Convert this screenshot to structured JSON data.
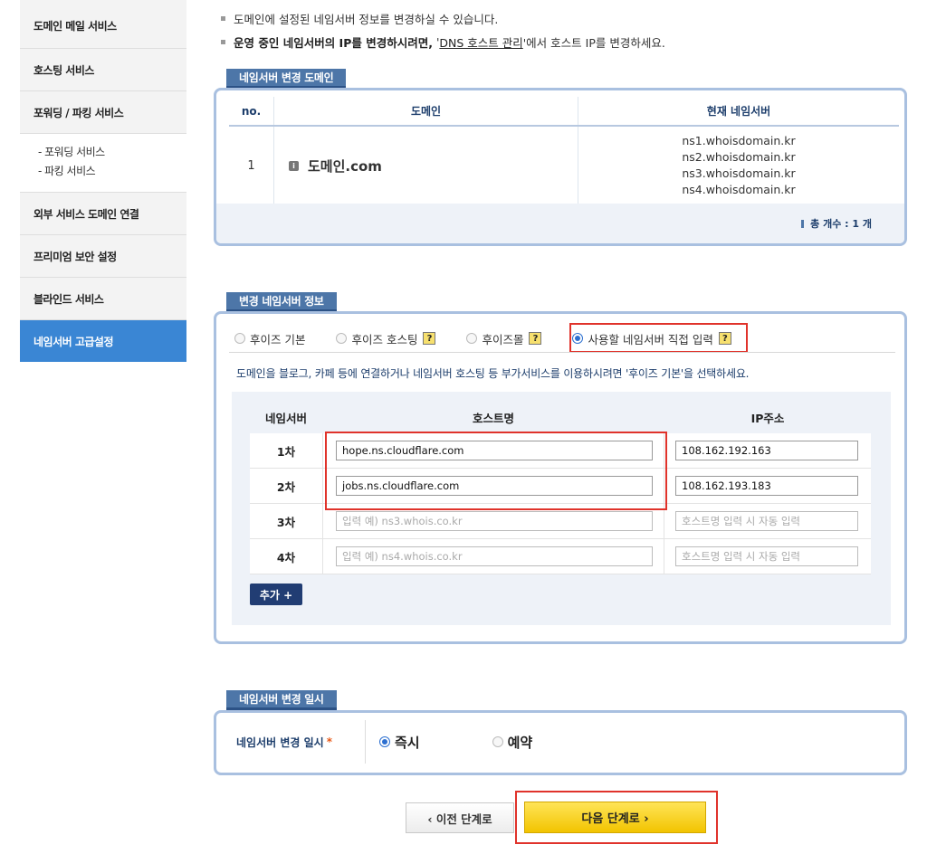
{
  "sidebar": {
    "items": [
      {
        "label": "도메인 메일 서비스"
      },
      {
        "label": "호스팅 서비스"
      },
      {
        "label": "포워딩 / 파킹 서비스"
      },
      {
        "label": "외부 서비스 도메인 연결"
      },
      {
        "label": "프리미엄 보안 설정"
      },
      {
        "label": "블라인드 서비스"
      },
      {
        "label": "네임서버 고급설정"
      }
    ],
    "sub_items": [
      "- 포워딩 서비스",
      "- 파킹 서비스"
    ]
  },
  "info": {
    "line1": "도메인에 설정된 네임서버 정보를 변경하실 수 있습니다.",
    "line2_bold": "운영 중인 네임서버의 IP를 변경하시려면,",
    "line2_q1": " '",
    "line2_link": "DNS 호스트 관리",
    "line2_rest": "'에서 호스트 IP를 변경하세요."
  },
  "section1": {
    "tab": "네임서버 변경 도메인",
    "headers": {
      "no": "no.",
      "domain": "도메인",
      "ns": "현재 네임서버"
    },
    "row": {
      "no": "1",
      "domain": "도메인.com",
      "nameservers": [
        "ns1.whoisdomain.kr",
        "ns2.whoisdomain.kr",
        "ns3.whoisdomain.kr",
        "ns4.whoisdomain.kr"
      ]
    },
    "total": "총 개수 : 1 개"
  },
  "section2": {
    "tab": "변경 네임서버 정보",
    "options": [
      {
        "label": "후이즈 기본",
        "selected": false,
        "help": false
      },
      {
        "label": "후이즈 호스팅",
        "selected": false,
        "help": true
      },
      {
        "label": "후이즈몰",
        "selected": false,
        "help": true
      },
      {
        "label": "사용할 네임서버 직접 입력",
        "selected": true,
        "help": true
      }
    ],
    "help_glyph": "?",
    "hint": "도메인을 블로그, 카페 등에 연결하거나 네임서버 호스팅 등 부가서비스를 이용하시려면 '후이즈 기본'을 선택하세요.",
    "headers": {
      "ns": "네임서버",
      "host": "호스트명",
      "ip": "IP주소"
    },
    "rows": [
      {
        "label": "1차",
        "host": "hope.ns.cloudflare.com",
        "ip": "108.162.192.163"
      },
      {
        "label": "2차",
        "host": "jobs.ns.cloudflare.com",
        "ip": "108.162.193.183"
      },
      {
        "label": "3차",
        "host_placeholder": "입력 예) ns3.whois.co.kr",
        "ip_placeholder": "호스트명 입력 시 자동 입력"
      },
      {
        "label": "4차",
        "host_placeholder": "입력 예) ns4.whois.co.kr",
        "ip_placeholder": "호스트명 입력 시 자동 입력"
      }
    ],
    "add_button": "추가 +"
  },
  "section3": {
    "tab": "네임서버 변경 일시",
    "label": "네임서버 변경 일시",
    "required_mark": "*",
    "options": [
      {
        "label": "즉시",
        "selected": true
      },
      {
        "label": "예약",
        "selected": false
      }
    ]
  },
  "buttons": {
    "prev": "‹  이전 단계로",
    "next": "다음 단계로  ›"
  },
  "colors": {
    "accent": "#3a86d4",
    "tab": "#4d76a8",
    "highlight_red": "#e0332b",
    "next_button": "#f2c400",
    "add_button": "#213d73"
  }
}
